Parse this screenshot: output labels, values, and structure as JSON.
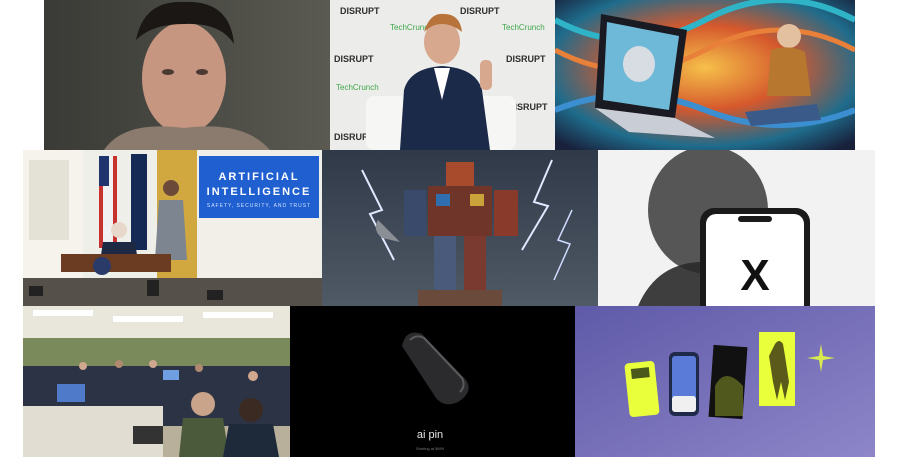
{
  "collage": {
    "photo_1": {
      "subject": "portrait-man-dark-hair"
    },
    "photo_2": {
      "backdrop_brand": "DISRUPT",
      "backdrop_brand_2": "TechCrunch"
    },
    "photo_3": {
      "subject": "psychedelic-robot-laptop-art"
    },
    "photo_4": {
      "sign_title_1": "ARTIFICIAL",
      "sign_title_2": "INTELLIGENCE",
      "sign_subtitle": "SAFETY, SECURITY, AND TRUST"
    },
    "photo_5": {
      "subject": "junk-robot-lightning"
    },
    "photo_6": {
      "logo": "X"
    },
    "photo_7": {
      "subject": "conference-room-meeting"
    },
    "photo_8": {
      "product_name": "ai pin",
      "product_tagline": "Starting at $699"
    },
    "photo_9": {
      "subject": "devices-on-purple-gradient"
    }
  },
  "colors": {
    "background": "#ffffff",
    "sign_blue": "#1f5fd0",
    "neon_yellow": "#e9ff3b",
    "purple_bg": "#6d68b8"
  }
}
